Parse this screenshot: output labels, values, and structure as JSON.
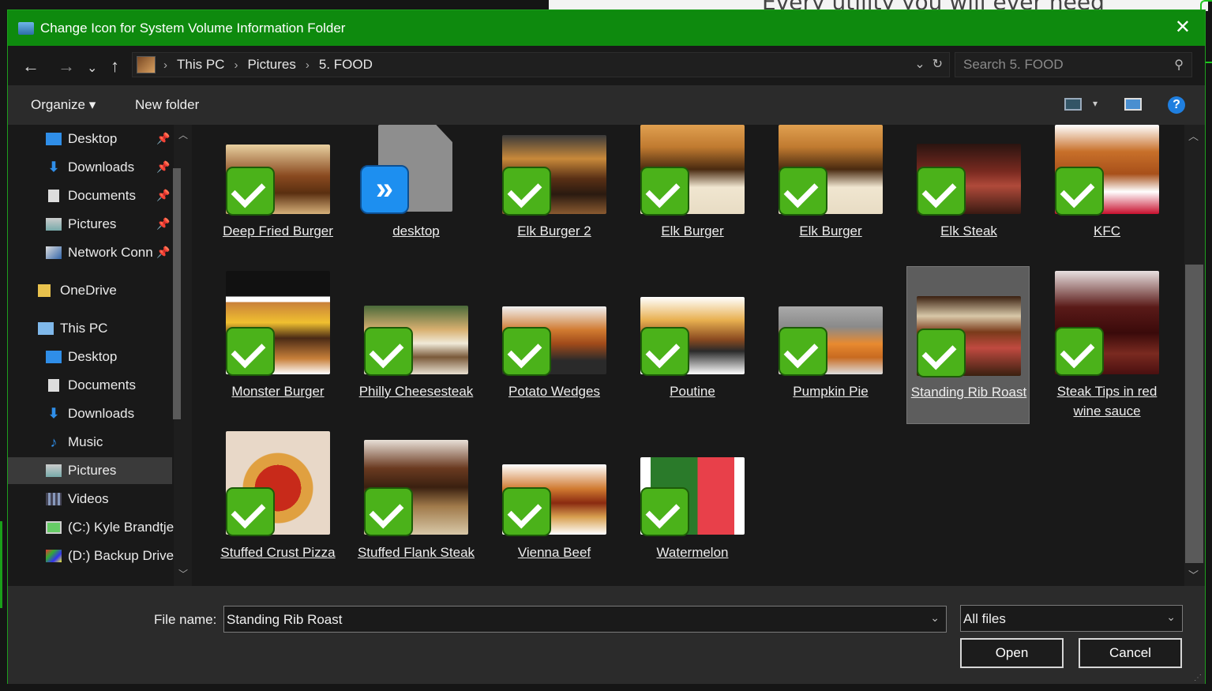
{
  "background": {
    "headline": "Every utility you will ever need"
  },
  "window": {
    "title": "Change Icon for System Volume Information Folder"
  },
  "nav": {
    "breadcrumbs": [
      "This PC",
      "Pictures",
      "5. FOOD"
    ],
    "search_placeholder": "Search 5. FOOD"
  },
  "toolbar": {
    "organize": "Organize",
    "new_folder": "New folder",
    "help": "?"
  },
  "sidebar": {
    "quick_access": [
      "Desktop",
      "Downloads",
      "Documents",
      "Pictures",
      "Network Conn"
    ],
    "onedrive": "OneDrive",
    "this_pc": "This PC",
    "pc_items": [
      "Desktop",
      "Documents",
      "Downloads",
      "Music",
      "Pictures",
      "Videos",
      "(C:) Kyle Brandtje",
      "(D:) Backup Drive"
    ],
    "selected": "Pictures"
  },
  "files": {
    "row1": [
      "Deep Fried Burger",
      "desktop",
      "Elk Burger 2",
      "Elk Burger",
      "Elk Burger",
      "Elk Steak",
      "KFC"
    ],
    "row2": [
      "Monster Burger",
      "Philly Cheesesteak",
      "Potato Wedges",
      "Poutine",
      "Pumpkin Pie",
      "Standing Rib Roast",
      "Steak Tips in red wine sauce"
    ],
    "row3": [
      "Stuffed Crust Pizza",
      "Stuffed Flank Steak",
      "Vienna Beef",
      "Watermelon"
    ],
    "selected": "Standing Rib Roast"
  },
  "footer": {
    "file_name_label": "File name:",
    "file_name_value": "Standing Rib Roast",
    "file_type": "All files",
    "open_label": "Open",
    "cancel_label": "Cancel"
  },
  "colors": {
    "title_green": "#0e8a0e",
    "check_green": "#4bb21a",
    "accent_blue": "#1d8ff0"
  }
}
